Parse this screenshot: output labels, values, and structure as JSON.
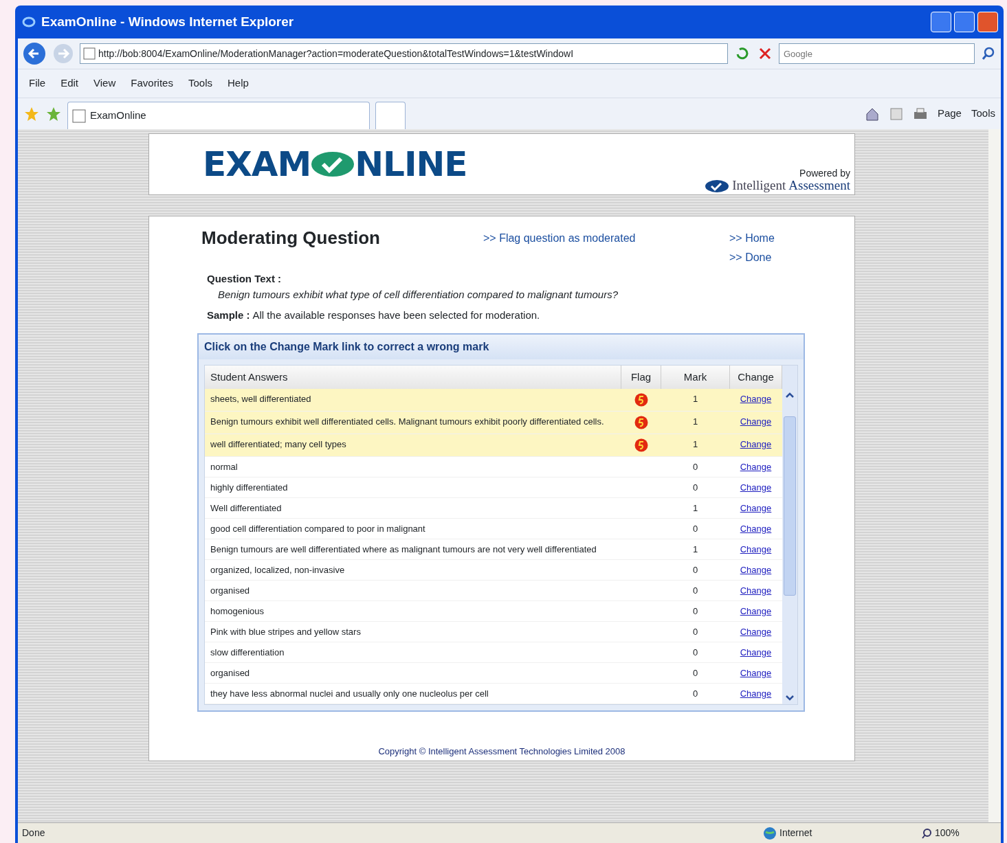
{
  "window": {
    "title": "ExamOnline - Windows Internet Explorer"
  },
  "address": {
    "url": "http://bob:8004/ExamOnline/ModerationManager?action=moderateQuestion&totalTestWindows=1&testWindowI",
    "search_placeholder": "Google"
  },
  "menu": [
    "File",
    "Edit",
    "View",
    "Favorites",
    "Tools",
    "Help"
  ],
  "tab": {
    "label": "ExamOnline"
  },
  "toolbar": [
    "Page",
    "Tools"
  ],
  "header": {
    "logo_left": "EXAM",
    "logo_right": "NLINE",
    "powered_by": "Powered by",
    "brand_left": "Intelligent",
    "brand_right": "Assessment"
  },
  "page": {
    "title": "Moderating Question",
    "flag_link": ">> Flag question as moderated",
    "links": [
      ">> Home",
      ">> Done"
    ],
    "question_label": "Question Text :",
    "question": "Benign tumours exhibit what type of cell differentiation compared to malignant tumours?",
    "sample_label": "Sample :",
    "sample": "All the available responses have been selected for moderation."
  },
  "table": {
    "caption": "Click on the Change Mark link to correct a wrong mark",
    "columns": [
      "Student Answers",
      "Flag",
      "Mark",
      "Change"
    ],
    "rows": [
      {
        "answer": "sheets, well differentiated",
        "flagged": true,
        "mark": "1",
        "change": "Change"
      },
      {
        "answer": "Benign tumours exhibit well differentiated cells. Malignant tumours exhibit poorly differentiated cells.",
        "flagged": true,
        "mark": "1",
        "change": "Change"
      },
      {
        "answer": "well differentiated; many cell types",
        "flagged": true,
        "mark": "1",
        "change": "Change"
      },
      {
        "answer": "normal",
        "flagged": false,
        "mark": "0",
        "change": "Change"
      },
      {
        "answer": "highly differentiated",
        "flagged": false,
        "mark": "0",
        "change": "Change"
      },
      {
        "answer": "Well differentiated",
        "flagged": false,
        "mark": "1",
        "change": "Change"
      },
      {
        "answer": "good cell differentiation compared to poor in malignant",
        "flagged": false,
        "mark": "0",
        "change": "Change"
      },
      {
        "answer": "Benign tumours are well differentiated where as malignant tumours are not very well differentiated",
        "flagged": false,
        "mark": "1",
        "change": "Change"
      },
      {
        "answer": "organized, localized, non-invasive",
        "flagged": false,
        "mark": "0",
        "change": "Change"
      },
      {
        "answer": "organised",
        "flagged": false,
        "mark": "0",
        "change": "Change"
      },
      {
        "answer": "homogenious",
        "flagged": false,
        "mark": "0",
        "change": "Change"
      },
      {
        "answer": "Pink with blue stripes and yellow stars",
        "flagged": false,
        "mark": "0",
        "change": "Change"
      },
      {
        "answer": "slow differentiation",
        "flagged": false,
        "mark": "0",
        "change": "Change"
      },
      {
        "answer": "organised",
        "flagged": false,
        "mark": "0",
        "change": "Change"
      },
      {
        "answer": "they have less abnormal nuclei and usually only one nucleolus per cell",
        "flagged": false,
        "mark": "0",
        "change": "Change"
      }
    ]
  },
  "footer": "Copyright © Intelligent Assessment Technologies Limited 2008",
  "status_bar": {
    "text": "Done",
    "zone": "Internet",
    "zoom": "100%"
  }
}
